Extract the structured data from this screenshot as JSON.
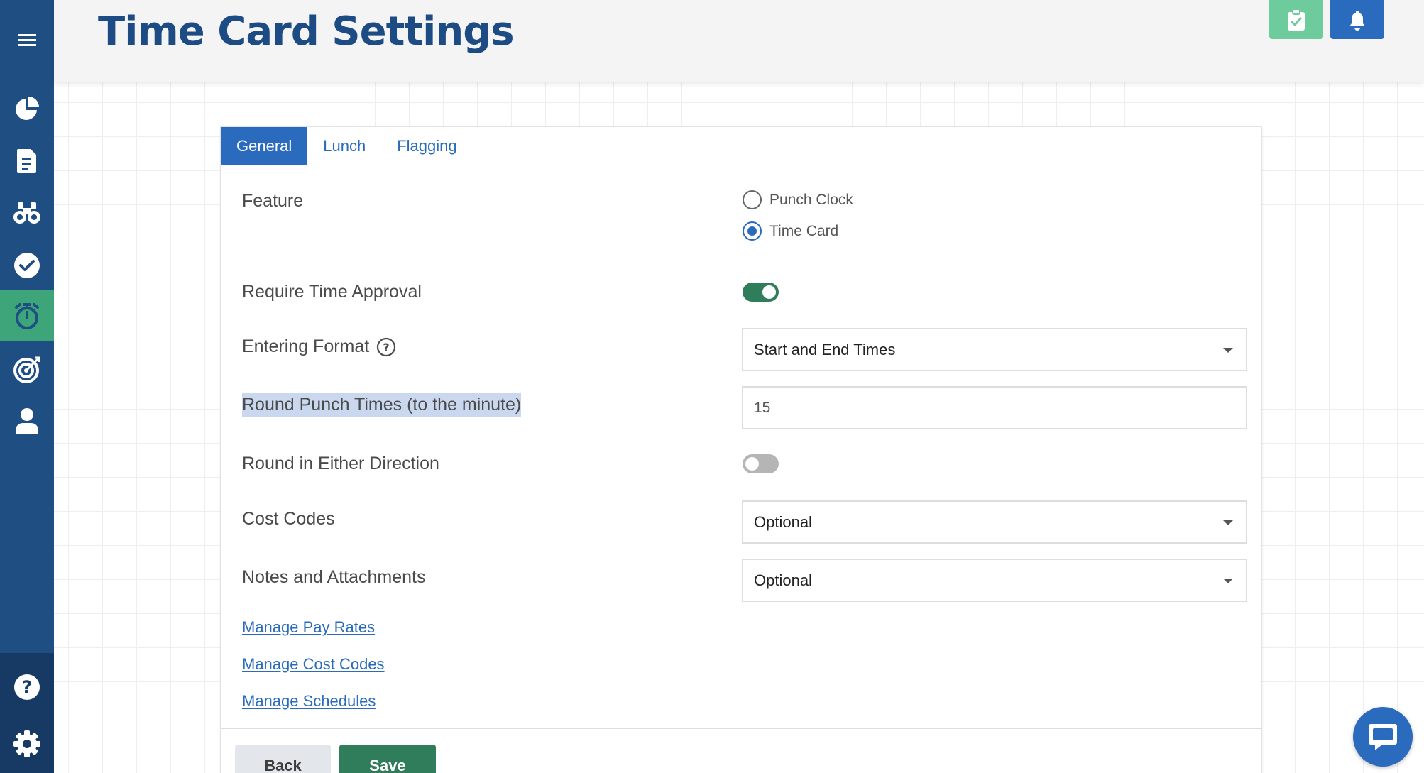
{
  "header": {
    "title": "Time Card Settings"
  },
  "tabs": [
    {
      "label": "General"
    },
    {
      "label": "Lunch"
    },
    {
      "label": "Flagging"
    }
  ],
  "settings": {
    "feature": {
      "label": "Feature",
      "options": [
        {
          "label": "Punch Clock",
          "checked": false
        },
        {
          "label": "Time Card",
          "checked": true
        }
      ]
    },
    "require_time_approval": {
      "label": "Require Time Approval",
      "enabled": true
    },
    "entering_format": {
      "label": "Entering Format",
      "value": "Start and End Times"
    },
    "round_punch_times": {
      "label": "Round Punch Times (to the minute)",
      "value": "15"
    },
    "round_either_direction": {
      "label": "Round in Either Direction",
      "enabled": false
    },
    "cost_codes": {
      "label": "Cost Codes",
      "value": "Optional"
    },
    "notes_attachments": {
      "label": "Notes and Attachments",
      "value": "Optional"
    }
  },
  "links": [
    {
      "label": "Manage Pay Rates"
    },
    {
      "label": "Manage Cost Codes"
    },
    {
      "label": "Manage Schedules"
    }
  ],
  "buttons": {
    "back": "Back",
    "save": "Save"
  },
  "colors": {
    "sidebar": "#1f4e83",
    "sidebar_active": "#3ea57a",
    "primary": "#2a6bbd",
    "success": "#2f7d5a",
    "title": "#1d4b84"
  },
  "icons": {
    "sidebar": [
      "menu-icon",
      "pie-chart-icon",
      "document-icon",
      "binoculars-icon",
      "check-circle-icon",
      "stopwatch-icon",
      "target-icon",
      "user-icon",
      "help-icon",
      "gear-icon"
    ],
    "header": [
      "clipboard-check-icon",
      "bell-icon"
    ],
    "chat": "chat-icon"
  }
}
